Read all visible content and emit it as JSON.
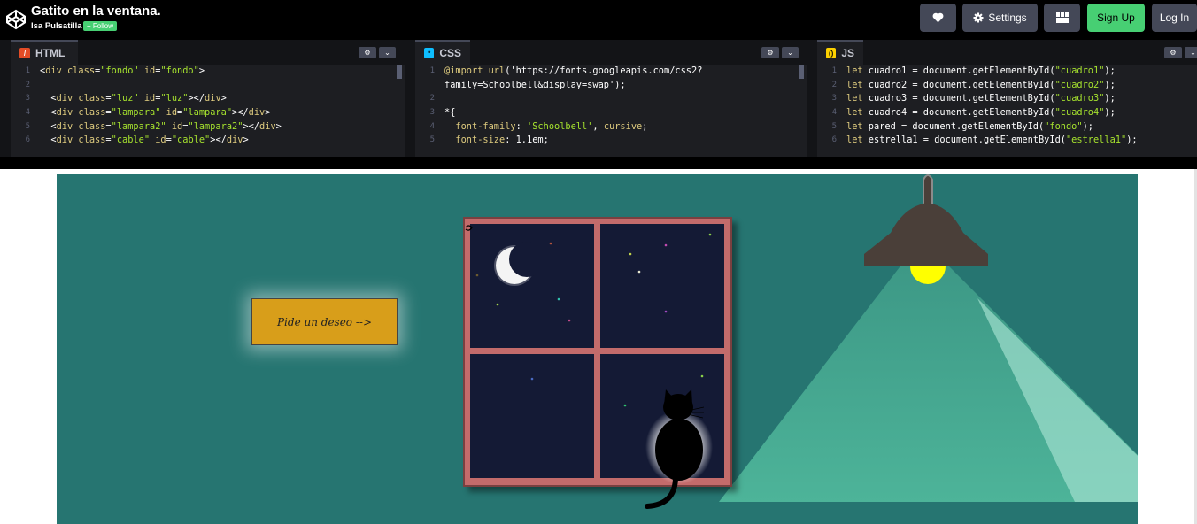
{
  "header": {
    "title": "Gatito en la ventana.",
    "author": "Isa Pulsatilla",
    "follow_label": "+ Follow",
    "settings_label": "Settings",
    "signup_label": "Sign Up",
    "login_label": "Log In"
  },
  "editors": {
    "html": {
      "label": "HTML",
      "lines": [
        {
          "n": "1",
          "text": "<div class=\"fondo\" id=\"fondo\">"
        },
        {
          "n": "2",
          "text": ""
        },
        {
          "n": "3",
          "text": "  <div class=\"luz\" id=\"luz\"></div>"
        },
        {
          "n": "4",
          "text": "  <div class=\"lampara\" id=\"lampara\"></div>"
        },
        {
          "n": "5",
          "text": "  <div class=\"lampara2\" id=\"lampara2\"></div>"
        },
        {
          "n": "6",
          "text": "  <div class=\"cable\" id=\"cable\"></div>"
        }
      ]
    },
    "css": {
      "label": "CSS",
      "lines": [
        {
          "n": "1",
          "text": "@import url('https://fonts.googleapis.com/css2?"
        },
        {
          "n": "",
          "text": "family=Schoolbell&display=swap');"
        },
        {
          "n": "2",
          "text": ""
        },
        {
          "n": "3",
          "text": "*{"
        },
        {
          "n": "4",
          "text": "  font-family: 'Schoolbell', cursive;"
        },
        {
          "n": "5",
          "text": "  font-size: 1.1em;"
        }
      ]
    },
    "js": {
      "label": "JS",
      "lines": [
        {
          "n": "1",
          "text": "let cuadro1 = document.getElementById(\"cuadro1\");"
        },
        {
          "n": "2",
          "text": "let cuadro2 = document.getElementById(\"cuadro2\");"
        },
        {
          "n": "3",
          "text": "let cuadro3 = document.getElementById(\"cuadro3\");"
        },
        {
          "n": "4",
          "text": "let cuadro4 = document.getElementById(\"cuadro4\");"
        },
        {
          "n": "5",
          "text": "let pared = document.getElementById(\"fondo\");"
        },
        {
          "n": "6",
          "text": "let estrella1 = document.getElementById(\"estrella1\");"
        }
      ]
    }
  },
  "preview": {
    "wish_button_label": "Pide un deseo -->"
  },
  "colors": {
    "wall": "#267571",
    "night_sky": "#141a35",
    "window_frame": "#c36b6b",
    "button": "#d89e1a",
    "lamp_shade": "#4a3f39",
    "bulb": "#ffff00",
    "light_cone": "#3f9f8a",
    "brand_green": "#47cf73"
  }
}
